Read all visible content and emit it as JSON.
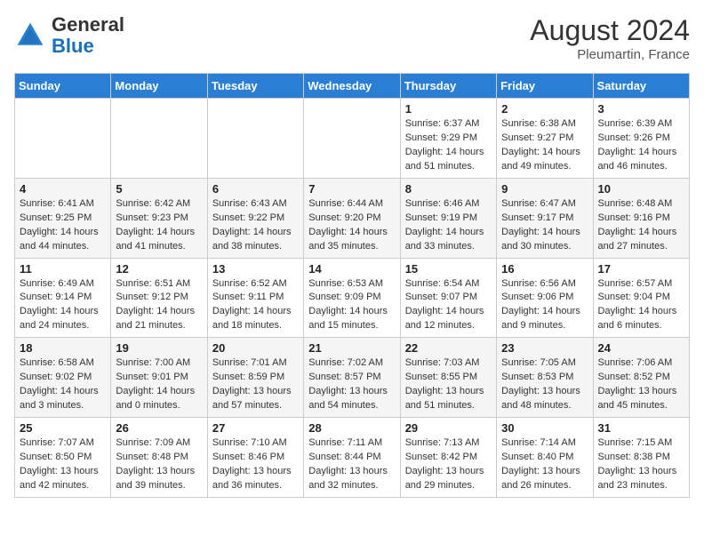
{
  "header": {
    "logo_general": "General",
    "logo_blue": "Blue",
    "month_year": "August 2024",
    "location": "Pleumartin, France"
  },
  "days_of_week": [
    "Sunday",
    "Monday",
    "Tuesday",
    "Wednesday",
    "Thursday",
    "Friday",
    "Saturday"
  ],
  "weeks": [
    [
      {
        "day": "",
        "info": ""
      },
      {
        "day": "",
        "info": ""
      },
      {
        "day": "",
        "info": ""
      },
      {
        "day": "",
        "info": ""
      },
      {
        "day": "1",
        "info": "Sunrise: 6:37 AM\nSunset: 9:29 PM\nDaylight: 14 hours\nand 51 minutes."
      },
      {
        "day": "2",
        "info": "Sunrise: 6:38 AM\nSunset: 9:27 PM\nDaylight: 14 hours\nand 49 minutes."
      },
      {
        "day": "3",
        "info": "Sunrise: 6:39 AM\nSunset: 9:26 PM\nDaylight: 14 hours\nand 46 minutes."
      }
    ],
    [
      {
        "day": "4",
        "info": "Sunrise: 6:41 AM\nSunset: 9:25 PM\nDaylight: 14 hours\nand 44 minutes."
      },
      {
        "day": "5",
        "info": "Sunrise: 6:42 AM\nSunset: 9:23 PM\nDaylight: 14 hours\nand 41 minutes."
      },
      {
        "day": "6",
        "info": "Sunrise: 6:43 AM\nSunset: 9:22 PM\nDaylight: 14 hours\nand 38 minutes."
      },
      {
        "day": "7",
        "info": "Sunrise: 6:44 AM\nSunset: 9:20 PM\nDaylight: 14 hours\nand 35 minutes."
      },
      {
        "day": "8",
        "info": "Sunrise: 6:46 AM\nSunset: 9:19 PM\nDaylight: 14 hours\nand 33 minutes."
      },
      {
        "day": "9",
        "info": "Sunrise: 6:47 AM\nSunset: 9:17 PM\nDaylight: 14 hours\nand 30 minutes."
      },
      {
        "day": "10",
        "info": "Sunrise: 6:48 AM\nSunset: 9:16 PM\nDaylight: 14 hours\nand 27 minutes."
      }
    ],
    [
      {
        "day": "11",
        "info": "Sunrise: 6:49 AM\nSunset: 9:14 PM\nDaylight: 14 hours\nand 24 minutes."
      },
      {
        "day": "12",
        "info": "Sunrise: 6:51 AM\nSunset: 9:12 PM\nDaylight: 14 hours\nand 21 minutes."
      },
      {
        "day": "13",
        "info": "Sunrise: 6:52 AM\nSunset: 9:11 PM\nDaylight: 14 hours\nand 18 minutes."
      },
      {
        "day": "14",
        "info": "Sunrise: 6:53 AM\nSunset: 9:09 PM\nDaylight: 14 hours\nand 15 minutes."
      },
      {
        "day": "15",
        "info": "Sunrise: 6:54 AM\nSunset: 9:07 PM\nDaylight: 14 hours\nand 12 minutes."
      },
      {
        "day": "16",
        "info": "Sunrise: 6:56 AM\nSunset: 9:06 PM\nDaylight: 14 hours\nand 9 minutes."
      },
      {
        "day": "17",
        "info": "Sunrise: 6:57 AM\nSunset: 9:04 PM\nDaylight: 14 hours\nand 6 minutes."
      }
    ],
    [
      {
        "day": "18",
        "info": "Sunrise: 6:58 AM\nSunset: 9:02 PM\nDaylight: 14 hours\nand 3 minutes."
      },
      {
        "day": "19",
        "info": "Sunrise: 7:00 AM\nSunset: 9:01 PM\nDaylight: 14 hours\nand 0 minutes."
      },
      {
        "day": "20",
        "info": "Sunrise: 7:01 AM\nSunset: 8:59 PM\nDaylight: 13 hours\nand 57 minutes."
      },
      {
        "day": "21",
        "info": "Sunrise: 7:02 AM\nSunset: 8:57 PM\nDaylight: 13 hours\nand 54 minutes."
      },
      {
        "day": "22",
        "info": "Sunrise: 7:03 AM\nSunset: 8:55 PM\nDaylight: 13 hours\nand 51 minutes."
      },
      {
        "day": "23",
        "info": "Sunrise: 7:05 AM\nSunset: 8:53 PM\nDaylight: 13 hours\nand 48 minutes."
      },
      {
        "day": "24",
        "info": "Sunrise: 7:06 AM\nSunset: 8:52 PM\nDaylight: 13 hours\nand 45 minutes."
      }
    ],
    [
      {
        "day": "25",
        "info": "Sunrise: 7:07 AM\nSunset: 8:50 PM\nDaylight: 13 hours\nand 42 minutes."
      },
      {
        "day": "26",
        "info": "Sunrise: 7:09 AM\nSunset: 8:48 PM\nDaylight: 13 hours\nand 39 minutes."
      },
      {
        "day": "27",
        "info": "Sunrise: 7:10 AM\nSunset: 8:46 PM\nDaylight: 13 hours\nand 36 minutes."
      },
      {
        "day": "28",
        "info": "Sunrise: 7:11 AM\nSunset: 8:44 PM\nDaylight: 13 hours\nand 32 minutes."
      },
      {
        "day": "29",
        "info": "Sunrise: 7:13 AM\nSunset: 8:42 PM\nDaylight: 13 hours\nand 29 minutes."
      },
      {
        "day": "30",
        "info": "Sunrise: 7:14 AM\nSunset: 8:40 PM\nDaylight: 13 hours\nand 26 minutes."
      },
      {
        "day": "31",
        "info": "Sunrise: 7:15 AM\nSunset: 8:38 PM\nDaylight: 13 hours\nand 23 minutes."
      }
    ]
  ]
}
